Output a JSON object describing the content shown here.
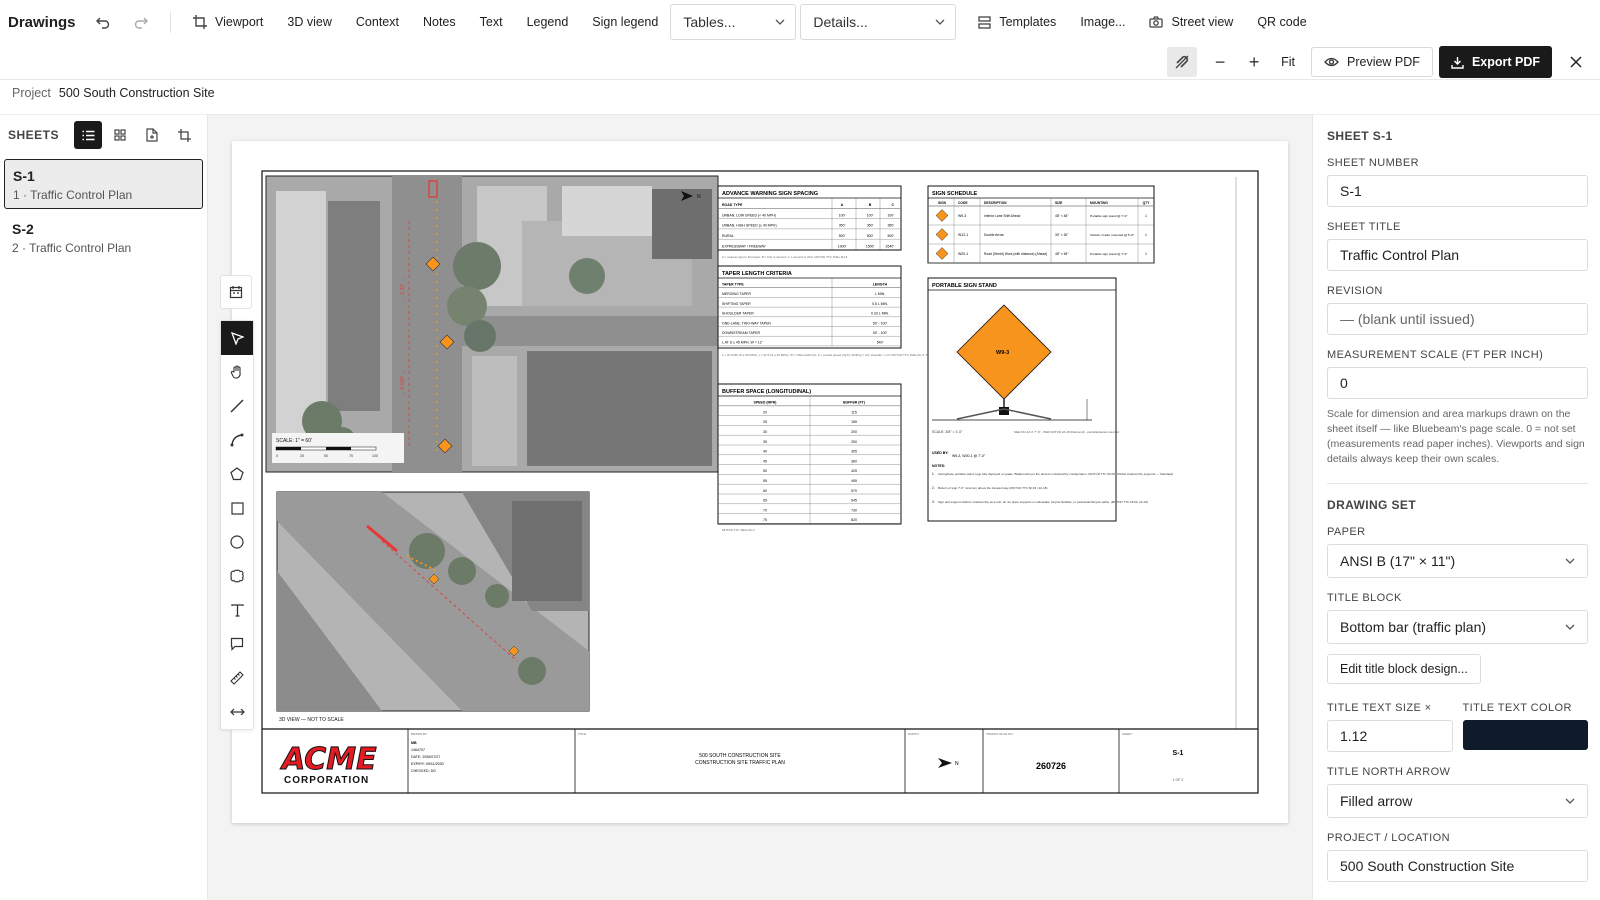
{
  "app": {
    "title": "Drawings"
  },
  "toolbar": {
    "viewport": "Viewport",
    "view3d": "3D view",
    "context": "Context",
    "notes": "Notes",
    "text": "Text",
    "legend": "Legend",
    "sign_legend": "Sign legend",
    "tables_select": "Tables...",
    "details_select": "Details...",
    "templates": "Templates",
    "image": "Image...",
    "street_view": "Street view",
    "qr_code": "QR code"
  },
  "zoombar": {
    "minus": "−",
    "plus": "+",
    "fit": "Fit",
    "preview": "Preview PDF",
    "export": "Export PDF"
  },
  "project": {
    "label": "Project",
    "name": "500 South Construction Site"
  },
  "sheets": {
    "title": "SHEETS",
    "items": [
      {
        "code": "S-1",
        "sub": "1 · Traffic Control Plan",
        "active": true
      },
      {
        "code": "S-2",
        "sub": "2 · Traffic Control Plan",
        "active": false
      }
    ]
  },
  "drawing": {
    "north": "N",
    "scale_label": "SCALE: 1\" = 60'",
    "scale_ticks": [
      "0",
      "25",
      "50",
      "75",
      "100"
    ],
    "dims": [
      "← 1 30' →",
      "← 0 100' →"
    ],
    "view3d_caption": "3D VIEW — NOT TO SCALE",
    "aws": {
      "title": "ADVANCE WARNING SIGN SPACING",
      "headers": [
        "ROAD TYPE",
        "A",
        "B",
        "C"
      ],
      "rows": [
        [
          "URBAN, LOW SPEED (< 40 MPH)",
          "100'",
          "100'",
          "100'"
        ],
        [
          "URBAN, HIGH SPEED (≥ 40 MPH)",
          "350'",
          "350'",
          "350'"
        ],
        [
          "RURAL",
          "500'",
          "500'",
          "500'"
        ],
        [
          "EXPRESSWAY / FREEWAY",
          "1000'",
          "1500'",
          "2640'"
        ]
      ],
      "note": "A = nearest sign to first taper, B = first to second, C = second to third. MUTCD TTC Table 6H-3"
    },
    "taper": {
      "title": "TAPER LENGTH CRITERIA",
      "headers": [
        "TAPER TYPE",
        "LENGTH"
      ],
      "rows": [
        [
          "MERGING TAPER",
          "L MIN."
        ],
        [
          "SHIFTING TAPER",
          "0.5 L MIN."
        ],
        [
          "SHOULDER TAPER",
          "0.33 L MIN."
        ],
        [
          "ONE-LANE, TWO-WAY TAPER",
          "50' - 100'"
        ],
        [
          "DOWNSTREAM TAPER",
          "50' - 100'"
        ],
        [
          "L AT S ≥ 45 MPH, W = 12'",
          "540'"
        ]
      ],
      "note": "L = W·S²/60 (S ≤ 40 MPH), L = W·S (S ≥ 45 MPH). W = offset width (ft), S = posted speed (mph). Shifting = L/2, shoulder = L/3. MUTCD TTC Table 6C-3, Table 6C-4"
    },
    "buffer": {
      "title": "BUFFER SPACE (LONGITUDINAL)",
      "headers": [
        "SPEED (MPH)",
        "BUFFER (FT)"
      ],
      "rows": [
        [
          "20",
          "115"
        ],
        [
          "25",
          "155"
        ],
        [
          "30",
          "200"
        ],
        [
          "35",
          "250"
        ],
        [
          "40",
          "305"
        ],
        [
          "45",
          "360"
        ],
        [
          "50",
          "425"
        ],
        [
          "55",
          "495"
        ],
        [
          "60",
          "570"
        ],
        [
          "65",
          "645"
        ],
        [
          "70",
          "730"
        ],
        [
          "75",
          "820"
        ]
      ],
      "note": "MUTCD TTC Table 6C-2"
    },
    "sign_schedule": {
      "title": "SIGN SCHEDULE",
      "headers": [
        "SIGN",
        "CODE",
        "DESCRIPTION",
        "SIZE",
        "MOUNTING",
        "QTY"
      ],
      "rows": [
        [
          "W9-3",
          "Interior Lane Shift Ahead",
          "48\" × 48\"",
          "Portable sign stand @ 7'-0\"",
          "1"
        ],
        [
          "W12-1",
          "Double Arrow",
          "30\" × 30\"",
          "Vehicle / trailer mounted @ 5'-0\"",
          "1"
        ],
        [
          "W20-1",
          "Road (Street) Work (with distance) (Ahead)",
          "48\" × 48\"",
          "Portable sign stand @ 7'-0\"",
          "1"
        ]
      ]
    },
    "sign_stand": {
      "title": "PORTABLE SIGN STAND",
      "sign_code": "W9-3",
      "scale": "SCALE: 3/8\" = 1'-0\"",
      "ref": "SEE FIG 2A 4' 7\"-0\" - PER MUTCD 2A.18 (Diamond) - portable/stand-mounted",
      "used_by_label": "USED BY:",
      "used_by": "W9-3, W20-1 @ 7'-0\"",
      "notes_label": "NOTES:",
      "notes": [
        "Spring/base portable stand, legs fully deployed on grade. Ballast with per the device's crashworthy configuration. (MUTCD TTC 6F.08 / MASH crashworthy supports — Standard)",
        "Bottom of sign 7'-0\" minimum above the traveled way (MUTCD TTC 6F.03 / 2A.18)",
        "Sign and support shall be crashworthy as a unit; do not place supports on sidewalks, bicycle facilities, or pedestrian/bicycle paths. (MUTCD TTC 6F.03, 2A.18)"
      ]
    },
    "title_block": {
      "logo_main": "ACME",
      "logo_sub": "CORPORATION",
      "drawn_by_label": "DRAWN BY",
      "drawn_by_lines": [
        "MB",
        "1464707",
        "DATE: 2026/07/27",
        "EXPIRY: 09/11/2030",
        "CHECKED: DG"
      ],
      "title_label": "TITLE",
      "title_lines": [
        "500 SOUTH CONSTRUCTION SITE",
        "CONSTRUCTION SITE TRAFFIC PLAN"
      ],
      "north_label": "NORTH",
      "plan_label": "TRAFFIC PLAN NO.",
      "plan_no": "260726",
      "sheet_label": "SHEET",
      "sheet_no": "S-1",
      "sheet_of": "1 OF 2"
    }
  },
  "props": {
    "header": "SHEET S-1",
    "sheet_number_label": "SHEET NUMBER",
    "sheet_number": "S-1",
    "sheet_title_label": "SHEET TITLE",
    "sheet_title": "Traffic Control Plan",
    "revision_label": "REVISION",
    "revision_placeholder": "— (blank until issued)",
    "scale_label": "MEASUREMENT SCALE (FT PER INCH)",
    "scale_value": "0",
    "scale_help": "Scale for dimension and area markups drawn on the sheet itself — like Bluebeam's page scale. 0 = not set (measurements read paper inches). Viewports and sign details always keep their own scales.",
    "drawing_set": "DRAWING SET",
    "paper_label": "PAPER",
    "paper_value": "ANSI B (17\" × 11\")",
    "title_block_label": "TITLE BLOCK",
    "title_block_value": "Bottom bar (traffic plan)",
    "edit_title_block": "Edit title block design...",
    "title_text_size_label": "TITLE TEXT SIZE ×",
    "title_text_size": "1.12",
    "title_text_color_label": "TITLE TEXT COLOR",
    "title_text_color": "#0f1b2a",
    "north_arrow_label": "TITLE NORTH ARROW",
    "north_arrow_value": "Filled arrow",
    "project_location_label": "PROJECT / LOCATION",
    "project_location": "500 South Construction Site"
  },
  "colors": {
    "accent_dark": "#1a1a1a",
    "sign_orange": "#f7941d",
    "logo_red": "#e31b23"
  }
}
